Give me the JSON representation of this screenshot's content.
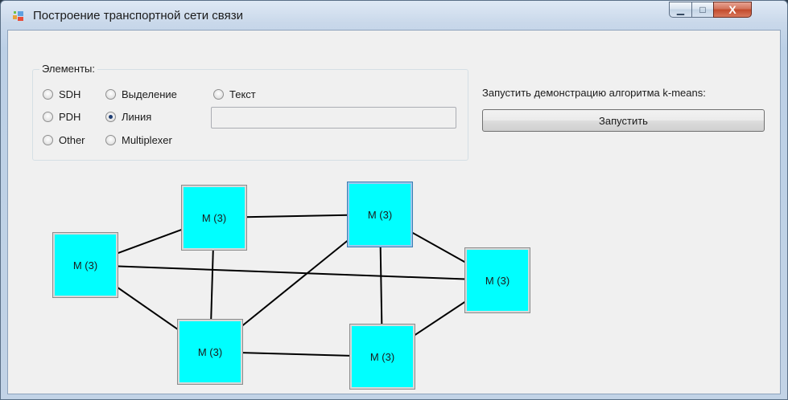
{
  "window": {
    "title": "Построение транспортной сети связи",
    "minimize_glyph": "▁",
    "maximize_glyph": "□",
    "close_glyph": "X"
  },
  "elements_group": {
    "title": "Элементы:",
    "radios": [
      {
        "label": "SDH",
        "checked": false
      },
      {
        "label": "PDH",
        "checked": false
      },
      {
        "label": "Other",
        "checked": false
      },
      {
        "label": "Выделение",
        "checked": false
      },
      {
        "label": "Линия",
        "checked": true
      },
      {
        "label": "Multiplexer",
        "checked": false
      },
      {
        "label": "Текст",
        "checked": false
      }
    ],
    "text_value": ""
  },
  "kmeans": {
    "label": "Запустить демонстрацию алгоритма k-means:",
    "button_label": "Запустить"
  },
  "graph": {
    "nodes": [
      {
        "label": "M (3)",
        "selected": false
      },
      {
        "label": "M (3)",
        "selected": false
      },
      {
        "label": "M (3)",
        "selected": true
      },
      {
        "label": "M (3)",
        "selected": false
      },
      {
        "label": "M (3)",
        "selected": false
      },
      {
        "label": "M (3)",
        "selected": false
      }
    ],
    "node_color": "#00ffff",
    "edges": [
      [
        0,
        1
      ],
      [
        0,
        3
      ],
      [
        0,
        4
      ],
      [
        1,
        2
      ],
      [
        1,
        4
      ],
      [
        2,
        3
      ],
      [
        2,
        4
      ],
      [
        2,
        5
      ],
      [
        3,
        5
      ],
      [
        4,
        5
      ]
    ]
  }
}
